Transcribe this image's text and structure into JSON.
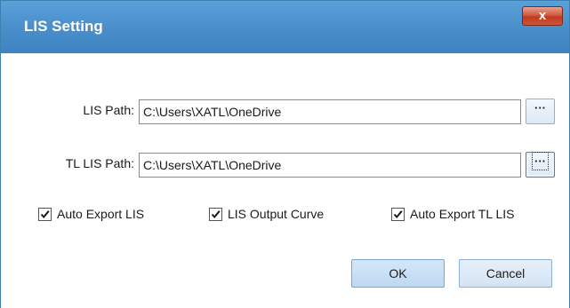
{
  "window": {
    "title": "LIS Setting",
    "close_glyph": "x"
  },
  "fields": {
    "lis_path": {
      "label": "LIS Path:",
      "value": "C:\\Users\\XATL\\OneDrive",
      "browse_label": "···"
    },
    "tl_lis_path": {
      "label": "TL LIS Path:",
      "value": "C:\\Users\\XATL\\OneDrive",
      "browse_label": "···"
    }
  },
  "options": [
    {
      "label": "Auto Export LIS",
      "checked": true
    },
    {
      "label": "LIS Output Curve",
      "checked": true
    },
    {
      "label": "Auto Export TL LIS",
      "checked": true
    }
  ],
  "buttons": {
    "ok": "OK",
    "cancel": "Cancel"
  },
  "colors": {
    "titlebar": "#4a8fcb",
    "close_button": "#c94a30",
    "button_fill": "#d5e7f8"
  }
}
